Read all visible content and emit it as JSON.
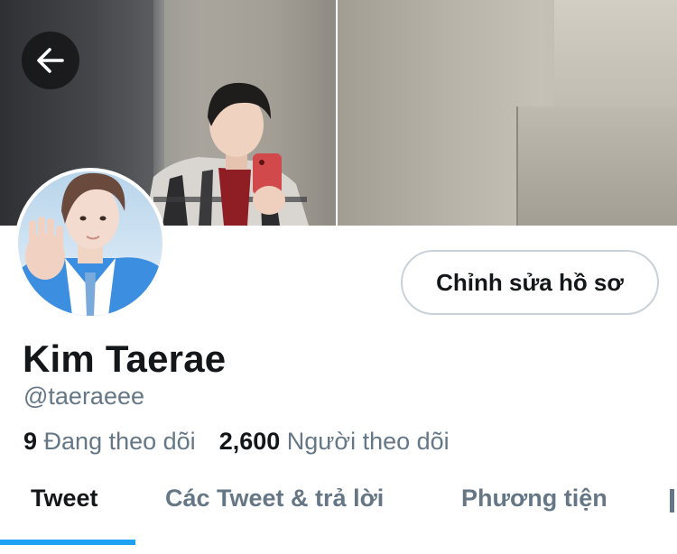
{
  "header": {
    "back_icon": "arrow-left-icon"
  },
  "profile": {
    "display_name": "Kim Taerae",
    "handle": "@taeraeee",
    "edit_button_label": "Chỉnh sửa hồ sơ",
    "following_count": "9",
    "following_label": "Đang theo dõi",
    "followers_count": "2,600",
    "followers_label": "Người theo dõi"
  },
  "tabs": [
    {
      "label": "Tweet",
      "active": true
    },
    {
      "label": "Các Tweet & trả lời",
      "active": false
    },
    {
      "label": "Phương tiện",
      "active": false
    }
  ],
  "colors": {
    "accent": "#1da1f2",
    "text_primary": "#14171a",
    "text_secondary": "#657786",
    "button_border": "#c9d2da"
  }
}
